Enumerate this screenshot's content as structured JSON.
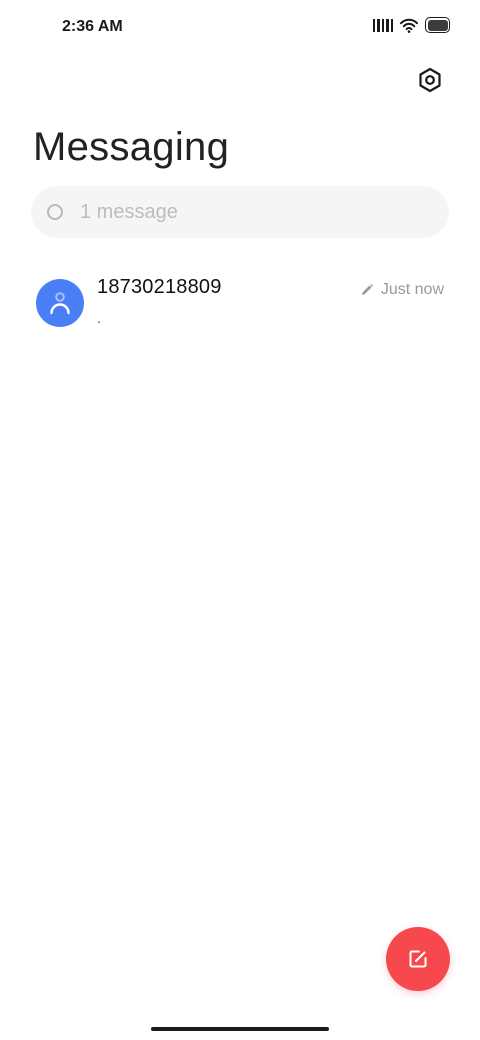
{
  "status_bar": {
    "time": "2:36 AM"
  },
  "header": {
    "title": "Messaging"
  },
  "search": {
    "placeholder": "1 message"
  },
  "conversations": [
    {
      "name": "18730218809",
      "snippet": ".",
      "status_icon": "draft-pencil-icon",
      "time": "Just now",
      "avatar_color": "#4a7ef6"
    }
  ],
  "colors": {
    "accent": "#f7484e",
    "avatar": "#4a7ef6",
    "search_bg": "#f5f5f5"
  },
  "icons": {
    "settings": "settings-hexagon-icon",
    "compose": "compose-icon",
    "search": "search-icon"
  }
}
